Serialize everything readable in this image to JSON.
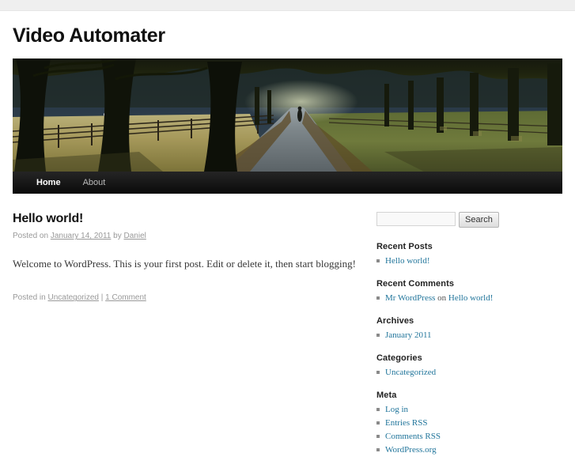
{
  "site": {
    "title": "Video Automater"
  },
  "header_image": {
    "alt": "Tree-lined lane with fence, frosted field and sheep"
  },
  "nav": {
    "items": [
      {
        "label": "Home",
        "current": true
      },
      {
        "label": "About",
        "current": false
      }
    ]
  },
  "post": {
    "title": "Hello world!",
    "meta": {
      "posted_on_prefix": "Posted on",
      "date": "January 14, 2011",
      "by": "by",
      "author": "Daniel"
    },
    "body": "Welcome to WordPress. This is your first post. Edit or delete it, then start blogging!",
    "footer": {
      "posted_in_prefix": "Posted in",
      "category": "Uncategorized",
      "separator": "|",
      "comments": "1 Comment"
    }
  },
  "sidebar": {
    "search": {
      "value": "",
      "placeholder": "",
      "button_label": "Search"
    },
    "widgets": [
      {
        "title": "Recent Posts",
        "items": [
          {
            "link": "Hello world!"
          }
        ]
      },
      {
        "title": "Recent Comments",
        "items": [
          {
            "link": "Mr WordPress",
            "middle": " on ",
            "link2": "Hello world!"
          }
        ]
      },
      {
        "title": "Archives",
        "items": [
          {
            "link": "January 2011"
          }
        ]
      },
      {
        "title": "Categories",
        "items": [
          {
            "link": "Uncategorized"
          }
        ]
      },
      {
        "title": "Meta",
        "items": [
          {
            "link": "Log in"
          },
          {
            "link": "Entries RSS"
          },
          {
            "link": "Comments RSS"
          },
          {
            "link": "WordPress.org"
          }
        ]
      }
    ]
  },
  "colors": {
    "link": "#21759b",
    "nav_background": "#222222",
    "meta_text": "#999999",
    "body_text": "#373737"
  }
}
